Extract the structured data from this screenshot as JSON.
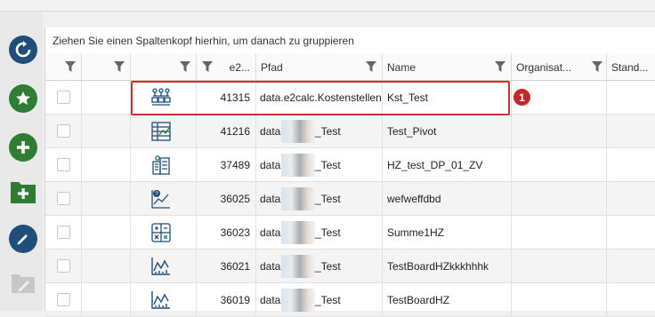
{
  "group_hint": "Ziehen Sie einen Spaltenkopf hierhin, um danach zu gruppieren",
  "columns": {
    "id": "e2...",
    "path": "Pfad",
    "name": "Name",
    "org": "Organisat...",
    "stand": "Stand..."
  },
  "left_toolbar": [
    "refresh-icon",
    "star-icon",
    "add-icon",
    "add-folder-icon",
    "edit-icon",
    "edit-folder-icon"
  ],
  "rows": [
    {
      "icon": "cost-centers-icon",
      "id": "41315",
      "path": "data.e2calc.Kostenstellen",
      "path_prefix": "data",
      "path_suffix": "",
      "name": "Kst_Test"
    },
    {
      "icon": "pivot-board-icon",
      "id": "41216",
      "path_prefix": "data",
      "path_suffix": "_Test",
      "name": "Test_Pivot"
    },
    {
      "icon": "building-calc-icon",
      "id": "37489",
      "path_prefix": "data",
      "path_suffix": "_Test",
      "name": "HZ_test_DP_01_ZV"
    },
    {
      "icon": "chart-person-icon",
      "id": "36025",
      "path_prefix": "data",
      "path_suffix": "_Test",
      "name": "wefweffdbd"
    },
    {
      "icon": "calculator-icon",
      "id": "36023",
      "path_prefix": "data",
      "path_suffix": "_Test",
      "name": "Summe1HZ"
    },
    {
      "icon": "line-chart-icon",
      "id": "36021",
      "path_prefix": "data",
      "path_suffix": "_Test",
      "name": "TestBoardHZkkkhhhk"
    },
    {
      "icon": "line-chart-icon",
      "id": "36019",
      "path_prefix": "data",
      "path_suffix": "_Test",
      "name": "TestBoardHZ"
    }
  ],
  "annotation_badge": "1",
  "colors": {
    "accent_blue": "#1f4e79",
    "accent_green": "#2e7d32",
    "highlight_red": "#d32f2f"
  }
}
